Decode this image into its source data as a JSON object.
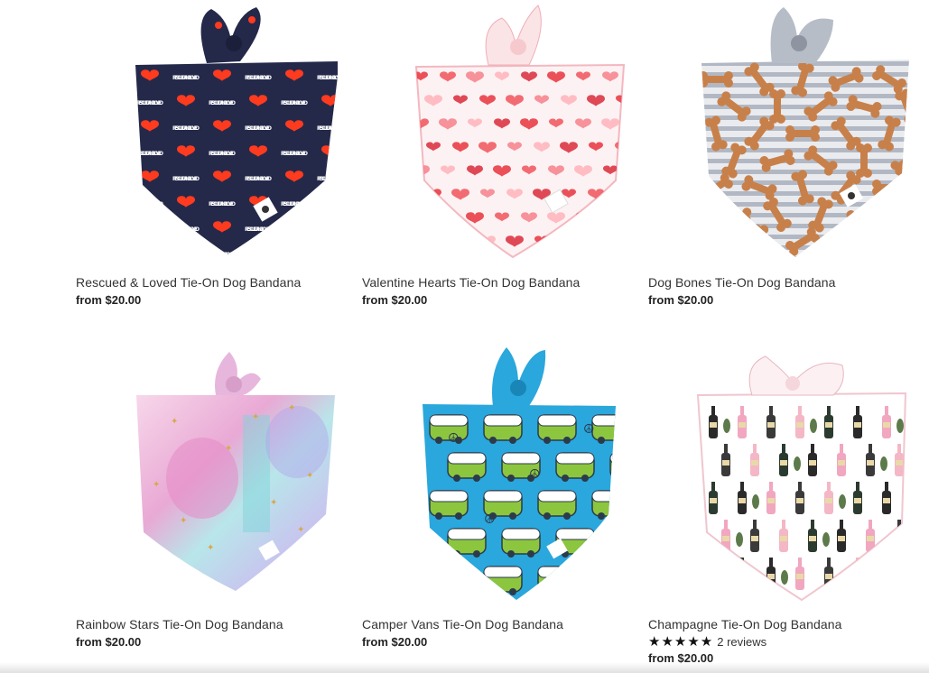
{
  "products": [
    {
      "title": "Rescued & Loved Tie-On Dog Bandana",
      "price": "from $20.00",
      "pattern": "rescued-loved"
    },
    {
      "title": "Valentine Hearts Tie-On Dog Bandana",
      "price": "from $20.00",
      "pattern": "valentine-hearts"
    },
    {
      "title": "Dog Bones Tie-On Dog Bandana",
      "price": "from $20.00",
      "pattern": "dog-bones"
    },
    {
      "title": "Rainbow Stars Tie-On Dog Bandana",
      "price": "from $20.00",
      "pattern": "rainbow-stars"
    },
    {
      "title": "Camper Vans Tie-On Dog Bandana",
      "price": "from $20.00",
      "pattern": "camper-vans"
    },
    {
      "title": "Champagne Tie-On Dog Bandana",
      "price": "from $20.00",
      "pattern": "champagne",
      "rating": {
        "stars": "★★★★★",
        "reviews": "2 reviews",
        "value": 5
      }
    }
  ],
  "bandana_text": "RESCUED AND LOVED",
  "colors": {
    "navy": "#24294a",
    "heart_red": "#ff3b1f",
    "pink_heart": "#f0545a",
    "bone_tan": "#c8804a",
    "stripe_gray": "#9aa3b0",
    "camper_blue": "#2aa7dc",
    "van_green": "#8cc63f"
  }
}
